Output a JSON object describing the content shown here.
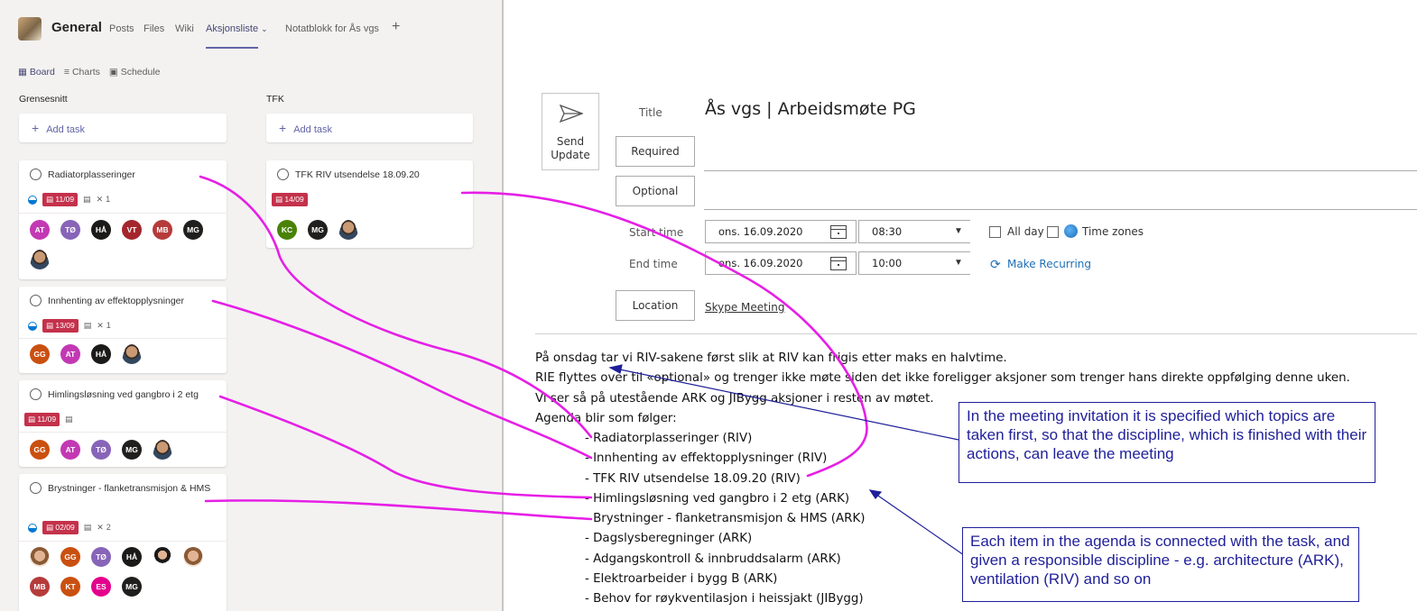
{
  "teams": {
    "channel": "General",
    "tabs": [
      "Posts",
      "Files",
      "Wiki"
    ],
    "active_tab": "Aksjonsliste",
    "notebook_tab": "Notatblokk for Ås vgs",
    "add_tab": "+",
    "views": [
      "Board",
      "Charts",
      "Schedule"
    ]
  },
  "buckets": [
    {
      "name": "Grensesnitt",
      "add_task": "Add task",
      "cards": [
        {
          "title": "Radiatorplasseringer",
          "due": "11/09",
          "attachments": "1",
          "avatars": [
            "AT",
            "TØ",
            "HÅ",
            "VT",
            "MB",
            "MG",
            "photo"
          ]
        },
        {
          "title": "Innhenting av effektopplysninger",
          "due": "13/09",
          "attachments": "1",
          "avatars": [
            "GG",
            "AT",
            "HÅ",
            "photo"
          ]
        },
        {
          "title": "Himlingsløsning ved gangbro i 2 etg",
          "due": "11/09",
          "avatars": [
            "GG",
            "AT",
            "TØ",
            "MG",
            "photo"
          ]
        },
        {
          "title": "Brystninger - flanketransmisjon & HMS",
          "due": "02/09",
          "attachments": "2",
          "avatars": [
            "photo-f",
            "GG",
            "TØ",
            "HÅ",
            "photo-f",
            "photo-f",
            "MB",
            "KT",
            "ES",
            "MG"
          ]
        }
      ]
    },
    {
      "name": "TFK",
      "add_task": "Add task",
      "cards": [
        {
          "title": "TFK RIV utsendelse 18.09.20",
          "due": "14/09",
          "avatars": [
            "KC",
            "MG",
            "photo"
          ]
        }
      ]
    }
  ],
  "avatar_colors": {
    "AT": "#c239b3",
    "TØ": "#8764b8",
    "HÅ": "#1b1a19",
    "VT": "#a4262c",
    "MB": "#b63b3b",
    "MG": "#201f1e",
    "GG": "#ca5010",
    "KT": "#ca5010",
    "ES": "#e3008c",
    "KC": "#498205"
  },
  "meeting": {
    "send_label": "Send Update",
    "title_label": "Title",
    "title": "Ås vgs | Arbeidsmøte PG",
    "required_label": "Required",
    "optional_label": "Optional",
    "start_label": "Start time",
    "end_label": "End time",
    "start_date": "ons. 16.09.2020",
    "start_time": "08:30",
    "end_date": "ons. 16.09.2020",
    "end_time": "10:00",
    "all_day_label": "All day",
    "time_zones_label": "Time zones",
    "recurring_label": "Make Recurring",
    "location_label": "Location",
    "location": "Skype Meeting"
  },
  "body": {
    "lines": [
      "På onsdag tar vi RIV-sakene først slik at RIV kan frigis etter maks en halvtime.",
      "RIE flyttes over til «optional» og trenger ikke møte siden det ikke foreligger aksjoner som trenger hans direkte oppfølging denne uken.",
      "Vi ser så på utestående ARK og JIBygg aksjoner i resten av møtet.",
      "Agenda blir som følger:"
    ],
    "agenda": [
      "- Radiatorplasseringer (RIV)",
      "- Innhenting av effektopplysninger (RIV)",
      "- TFK RIV utsendelse 18.09.20 (RIV)",
      "- Himlingsløsning ved gangbro i 2 etg (ARK)",
      "- Brystninger - flanketransmisjon & HMS (ARK)",
      "- Dagslysberegninger (ARK)",
      "- Adgangskontroll & innbruddsalarm (ARK)",
      "- Elektroarbeider i bygg B (ARK)",
      "- Behov for røykventilasjon i heissjakt (JIBygg)"
    ]
  },
  "callouts": [
    "In the meeting invitation it is specified which topics are taken first, so that the discipline, which is finished with their actions, can leave the meeting",
    "Each item in the agenda is connected with the task, and given a responsible discipline - e.g. architecture (ARK), ventilation (RIV) and so on"
  ],
  "colors": {
    "annotation_magenta": "#e61fe6",
    "callout_blue": "#1f1f9a",
    "teams_purple": "#6264a7",
    "due_red": "#c4314b"
  }
}
